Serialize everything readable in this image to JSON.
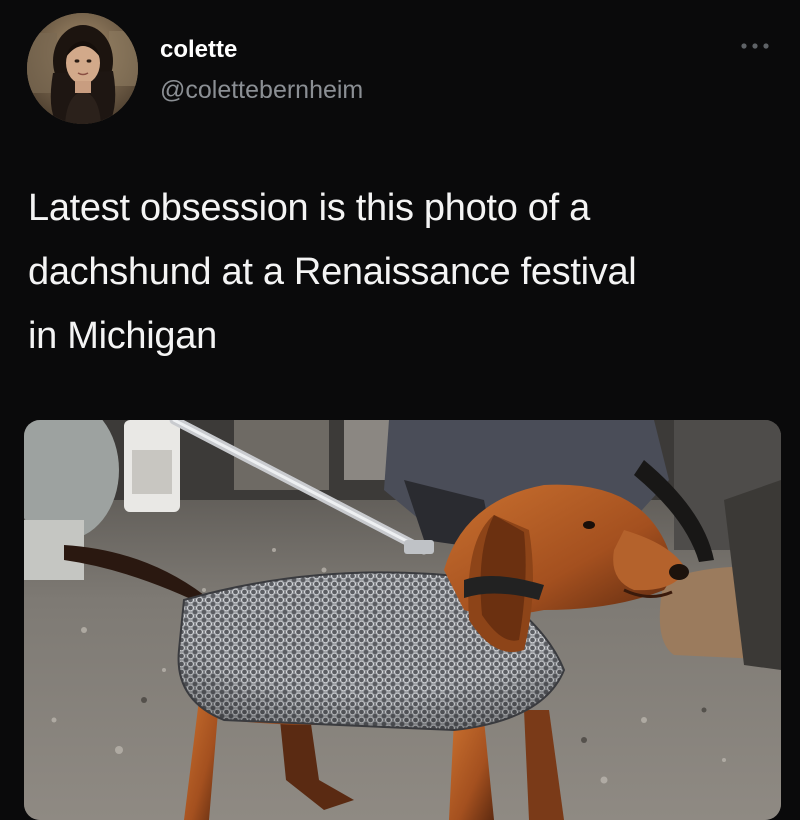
{
  "author": {
    "display_name": "colette",
    "handle": "@colettebernheim"
  },
  "tweet": {
    "text_lines": [
      "Latest obsession is this photo of a",
      "dachshund at a Renaissance festival",
      "in Michigan"
    ]
  },
  "icons": {
    "more": "more-horizontal-icon"
  },
  "colors": {
    "background": "#0a0a0b",
    "text_primary": "#f4f4f4",
    "text_secondary": "#8b8f94"
  }
}
